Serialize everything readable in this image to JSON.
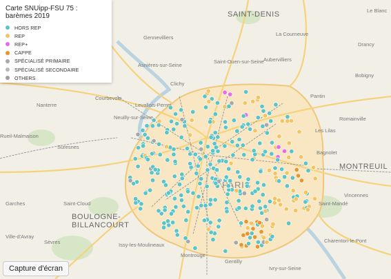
{
  "map": {
    "colors": {
      "background": "#f2efe6",
      "city_zone": "#f8e7c2",
      "park": "#d8e6c8",
      "water": "#b9d3e0",
      "road": "#f6d27a",
      "rail": "#9a9a9a"
    },
    "places": [
      {
        "key": "saint-denis",
        "text": "SAINT-DENIS",
        "size": "big"
      },
      {
        "key": "le-blanc",
        "text": "Le Blanc"
      },
      {
        "key": "gennevilliers",
        "text": "Gennevilliers"
      },
      {
        "key": "la-courneuve",
        "text": "La Courneuve"
      },
      {
        "key": "saint-ouen",
        "text": "Saint-Ouen-sur-Seine"
      },
      {
        "key": "asnieres",
        "text": "Asnières-sur-Seine"
      },
      {
        "key": "aubervilliers",
        "text": "Aubervilliers"
      },
      {
        "key": "drancy",
        "text": "Drancy"
      },
      {
        "key": "bobigny",
        "text": "Bobigny"
      },
      {
        "key": "clichy",
        "text": "Clichy"
      },
      {
        "key": "pantin",
        "text": "Pantin"
      },
      {
        "key": "nanterre",
        "text": "Nanterre"
      },
      {
        "key": "courbevoie",
        "text": "Courbevoie"
      },
      {
        "key": "levallois",
        "text": "Levallois-Perret"
      },
      {
        "key": "romainville",
        "text": "Romainville"
      },
      {
        "key": "neuilly",
        "text": "Neuilly-sur-Seine"
      },
      {
        "key": "les-lilas",
        "text": "Les Lilas"
      },
      {
        "key": "rueil",
        "text": "Rueil-Malmaison"
      },
      {
        "key": "bagnolet",
        "text": "Bagnolet"
      },
      {
        "key": "suresnes",
        "text": "Suresnes"
      },
      {
        "key": "montreuil",
        "text": "MONTREUIL",
        "size": "big"
      },
      {
        "key": "paris",
        "text": "PARIS",
        "size": "paris"
      },
      {
        "key": "vincennes",
        "text": "Vincennes"
      },
      {
        "key": "garches",
        "text": "Garches"
      },
      {
        "key": "saint-cloud",
        "text": "Saint-Cloud"
      },
      {
        "key": "saint-mande",
        "text": "Saint-Mandé"
      },
      {
        "key": "boulogne",
        "text": "BOULOGNE-BILLANCOURT",
        "size": "big"
      },
      {
        "key": "ville-davray",
        "text": "Ville-d'Avray"
      },
      {
        "key": "sevres",
        "text": "Sèvres"
      },
      {
        "key": "issy",
        "text": "Issy-les-Moulineaux"
      },
      {
        "key": "charenton",
        "text": "Charenton-le-Pont"
      },
      {
        "key": "montrouge",
        "text": "Montrouge"
      },
      {
        "key": "gentilly",
        "text": "Gentilly"
      },
      {
        "key": "ivry",
        "text": "Ivry-sur-Seine"
      }
    ],
    "categories": [
      {
        "key": "hors-rep",
        "label": "HORS REP",
        "color": "#5cc3c7"
      },
      {
        "key": "rep",
        "label": "REP",
        "color": "#f2c463"
      },
      {
        "key": "rep-plus",
        "label": "REP+",
        "color": "#e76be6"
      },
      {
        "key": "cappe",
        "label": "CAPPE",
        "color": "#e8962c"
      },
      {
        "key": "specialise-primaire",
        "label": "SPÉCIALISÉ PRIMAIRE",
        "color": "#a8a8a8"
      },
      {
        "key": "specialise-secondaire",
        "label": "SPÉCIALISÉ SECONDAIRE",
        "color": "#b8b8b8"
      },
      {
        "key": "others",
        "label": "OTHERS",
        "color": "#9e9e9e"
      }
    ]
  },
  "legend": {
    "title": "Carte SNUipp-FSU 75 : barèmes 2019"
  },
  "controls": {
    "capture_label": "Capture d'écran"
  }
}
